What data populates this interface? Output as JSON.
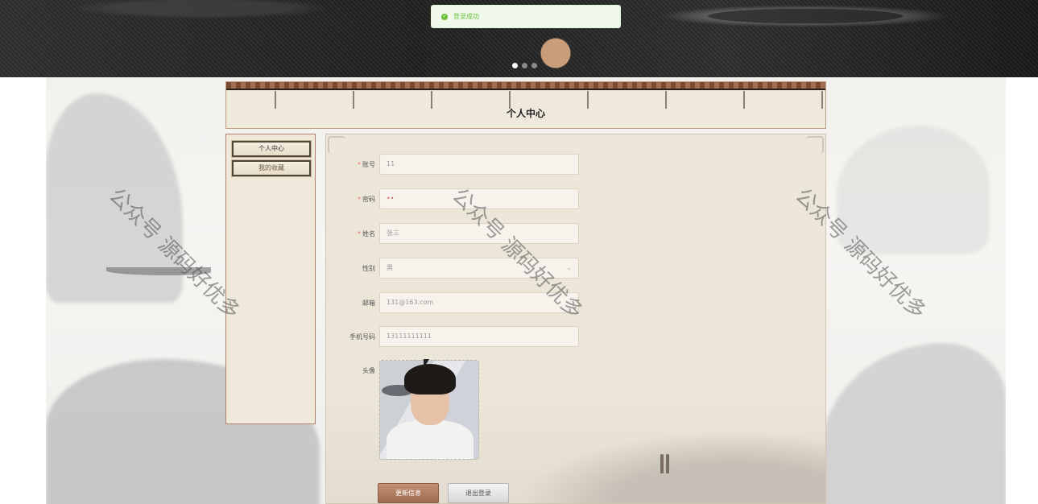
{
  "toast": {
    "message": "登录成功",
    "icon": "success-check-icon",
    "color": "#67c23a"
  },
  "carousel": {
    "slide_count": 3,
    "active_index": 0
  },
  "header": {
    "title": "个人中心"
  },
  "sidebar": {
    "items": [
      {
        "label": "个人中心"
      },
      {
        "label": "我的收藏"
      }
    ]
  },
  "form": {
    "account": {
      "label": "账号",
      "required": true,
      "value": "11"
    },
    "password": {
      "label": "密码",
      "required": true,
      "value": "••"
    },
    "name": {
      "label": "姓名",
      "required": true,
      "value": "张三"
    },
    "gender": {
      "label": "性别",
      "required": false,
      "value": "男"
    },
    "email": {
      "label": "邮箱",
      "required": false,
      "value": "131@163.com"
    },
    "phone": {
      "label": "手机号码",
      "required": false,
      "value": "13111111111"
    },
    "avatar": {
      "label": "头像"
    }
  },
  "buttons": {
    "update": "更新信息",
    "logout": "退出登录"
  },
  "watermark": "公众号 源码好优多",
  "colors": {
    "primary_button": "#a6735a",
    "required_mark": "#f56c6c",
    "panel_bg": "#ede7da"
  }
}
